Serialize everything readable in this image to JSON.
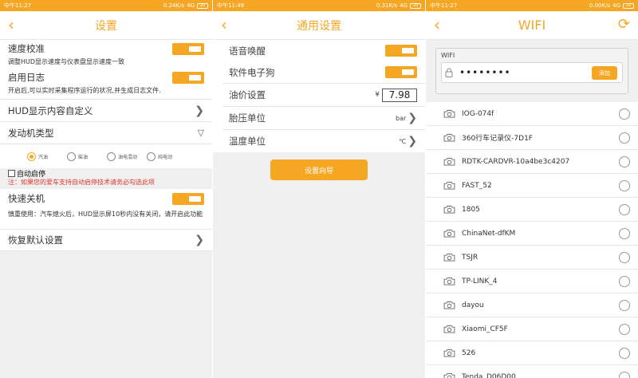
{
  "colors": {
    "accent": "#f5a623",
    "warning": "#e8342c"
  },
  "screen1": {
    "status": {
      "left": "中午11:27",
      "speed": "0.24K/s",
      "network": "4G",
      "battery": "20"
    },
    "title": "设置",
    "speed_calibration": "速度校准",
    "speed_calibration_desc": "调整HUD显示速度与仪表盘显示速度一致",
    "enable_log": "启用日志",
    "enable_log_desc": "开启后,可以实时采集程序运行的状况,并生成日志文件.",
    "hud_custom": "HUD显示内容自定义",
    "engine_type": "发动机类型",
    "engine_options": [
      "汽油",
      "柴油",
      "油电混动",
      "纯电动"
    ],
    "auto_stop": "自动启停",
    "auto_stop_warning": "注：如果您的爱车支持自动启停技术请务必勾选此项",
    "fast_shutdown": "快速关机",
    "fast_shutdown_desc": "慎重使用：汽车熄火后，HUD显示屏10秒内没有关闭，请开启此功能",
    "restore_defaults": "恢复默认设置"
  },
  "screen2": {
    "status": {
      "left": "中午11:49",
      "speed": "0.31K/s",
      "network": "4G",
      "battery": "20"
    },
    "title": "通用设置",
    "voice_wake": "语音唤醒",
    "e_dog": "软件电子狗",
    "fuel_price": "油价设置",
    "currency": "¥",
    "fuel_price_value": "7.98",
    "tire_unit": "胎压单位",
    "tire_unit_value": "bar",
    "temp_unit": "温度单位",
    "temp_unit_value": "℃",
    "wizard_button": "设置向导"
  },
  "screen3": {
    "status": {
      "left": "中午11:27",
      "speed": "0.00K/s",
      "network": "4G",
      "battery": "20"
    },
    "title": "WIFI",
    "wifi_label": "WIFI",
    "password_mask": "••••••••",
    "add_button": "添加",
    "networks": [
      "IOG-074f",
      "360行车记录仪-7D1F",
      "RDTK-CARDVR-10a4be3c4207",
      "FAST_52",
      "1805",
      "ChinaNet-dfKM",
      "TSJR",
      "TP-LINK_4",
      "dayou",
      "Xiaomi_CF5F",
      "526",
      "Tenda_D06D00"
    ]
  }
}
